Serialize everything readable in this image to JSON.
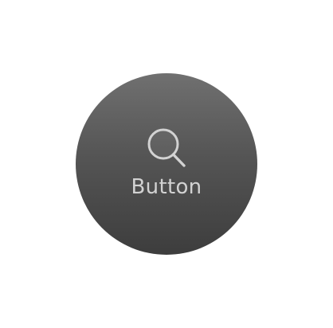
{
  "button": {
    "label": "Button",
    "icon": "search-icon"
  },
  "colors": {
    "button_top": "#707070",
    "button_bottom": "#3d3d3d",
    "foreground": "#d2d2d2"
  }
}
